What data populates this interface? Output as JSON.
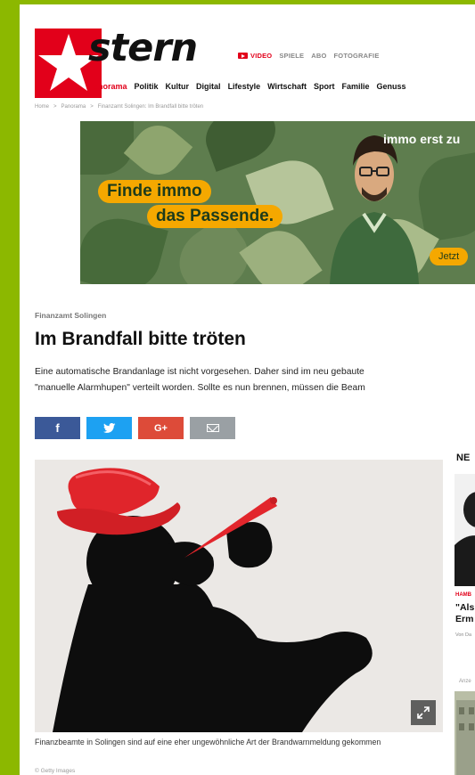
{
  "brand": {
    "name": "stern",
    "accent": "#e2001a",
    "background": "#8cb800"
  },
  "top_nav": {
    "video": "VIDEO",
    "items": [
      "SPIELE",
      "ABO",
      "FOTOGRAFIE"
    ]
  },
  "main_nav": [
    "Panorama",
    "Politik",
    "Kultur",
    "Digital",
    "Lifestyle",
    "Wirtschaft",
    "Sport",
    "Familie",
    "Genuss"
  ],
  "breadcrumb": [
    "Home",
    ">",
    "Panorama",
    ">",
    "Finanzamt Solingen: Im Brandfall bitte tröten"
  ],
  "ad": {
    "line1": "Finde immo",
    "line2": "das Passende.",
    "tagline": "immo erst zu",
    "cta": "Jetzt"
  },
  "article": {
    "kicker": "Finanzamt Solingen",
    "headline": "Im Brandfall bitte tröten",
    "teaser_line1": "Eine automatische Brandanlage ist nicht vorgesehen. Daher sind im neu gebaute",
    "teaser_line2": "\"manuelle Alarmhupen\" verteilt worden. Sollte es nun brennen, müssen die Beam",
    "share": {
      "facebook": "f",
      "twitter": "t",
      "googleplus": "G+",
      "email": "mail-icon"
    },
    "caption": "Finanzbeamte in Solingen sind auf eine eher ungewöhnliche Art der Brandwarnmeldung gekommen",
    "credit": "© Getty Images"
  },
  "sidebar": {
    "heading": "NE",
    "kicker": "HAMB",
    "title_line1": "\"Als",
    "title_line2": "Erm",
    "byline": "Von Da",
    "ad_label": "Anze"
  }
}
